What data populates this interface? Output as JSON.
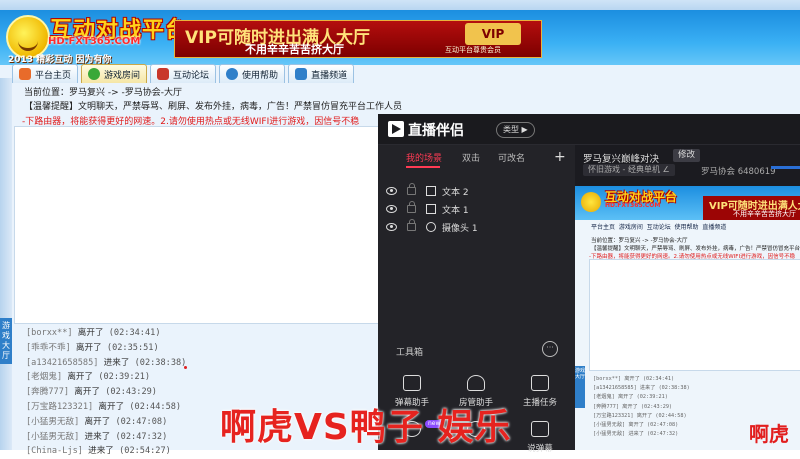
{
  "lobby": {
    "logo": {
      "title": "互动对战平台",
      "url": "HD.FXT365.COM",
      "slogan": "2013 精彩互动 因为有你"
    },
    "vip": {
      "title": "VIP可随时进出满人大厅",
      "subtitle": "不用辛辛苦苦挤大厅",
      "badge": "VIP",
      "footer": "互动平台尊贵会员"
    },
    "tabs": [
      {
        "label": "平台主页",
        "icon": "home-icon",
        "color": "#e86b2a"
      },
      {
        "label": "游戏房间",
        "icon": "game-room-icon",
        "color": "#3aa838",
        "active": true
      },
      {
        "label": "互动论坛",
        "icon": "forum-icon",
        "color": "#c8372b"
      },
      {
        "label": "使用帮助",
        "icon": "help-icon",
        "color": "#2f7fc9"
      },
      {
        "label": "直播频道",
        "icon": "live-channel-icon",
        "color": "#2f7fc9"
      }
    ],
    "breadcrumb": "当前位置：罗马复兴 -> -罗马协会-大厅",
    "notice": "【温馨提醒】文明聊天，严禁辱骂、刷屏、发布外挂，病毒，广告！严禁冒仿冒充平台工作人员",
    "warning": "-下路由器，将能获得更好的网速。2.请勿使用热点或无线WIFI进行游戏，因信号不稳",
    "side_rail_label": "游戏大厅",
    "log": [
      {
        "name": "[borxx**]",
        "action": "离开了",
        "time": "(02:34:41)"
      },
      {
        "name": "[乖乖不乖]",
        "action": "离开了",
        "time": "(02:35:51)"
      },
      {
        "name": "[a13421658585]",
        "action": "进来了",
        "time": "(02:38:38)"
      },
      {
        "name": "[老烟鬼]",
        "action": "离开了",
        "time": "(02:39:21)"
      },
      {
        "name": "[奔腾777]",
        "action": "离开了",
        "time": "(02:43:29)"
      },
      {
        "name": "[万宝路123321]",
        "action": "离开了",
        "time": "(02:44:58)"
      },
      {
        "name": "[小猛男无敌]",
        "action": "离开了",
        "time": "(02:47:08)"
      },
      {
        "name": "[小猛男无敌]",
        "action": "进来了",
        "time": "(02:47:32)"
      },
      {
        "name": "[China-Ljs]",
        "action": "进来了",
        "time": "(02:54:27)"
      }
    ]
  },
  "stream": {
    "app_title": "直播伴侣",
    "type_pill": "类型 ▶",
    "scene_tabs": [
      "我的场景",
      "双击",
      "可改名"
    ],
    "add_symbol": "+",
    "sources": [
      {
        "label": "文本 2",
        "icon": "text-source-icon"
      },
      {
        "label": "文本 1",
        "icon": "text-source-icon"
      },
      {
        "label": "摄像头 1",
        "icon": "camera-source-icon"
      }
    ],
    "toolbox_label": "工具箱",
    "toolbox_more": "···",
    "tools": [
      {
        "label": "弹幕助手",
        "icon": "danmaku-icon"
      },
      {
        "label": "房管助手",
        "icon": "room-admin-icon"
      },
      {
        "label": "主播任务",
        "icon": "task-icon"
      },
      {
        "label": "",
        "icon": "music-icon"
      },
      {
        "label": "",
        "icon": "download-icon"
      },
      {
        "label": "说弹幕",
        "icon": "speak-danmaku-icon"
      }
    ],
    "new_badge": "new",
    "stream_name": "罗马复兴巅峰对决",
    "edit_label": "修改",
    "category": "怀旧游戏 - 经典单机 ∠",
    "room_info": "罗马协会  6480619",
    "mini_overlay": "啊虎"
  },
  "caption": "啊虎VS鸭子 娱乐"
}
